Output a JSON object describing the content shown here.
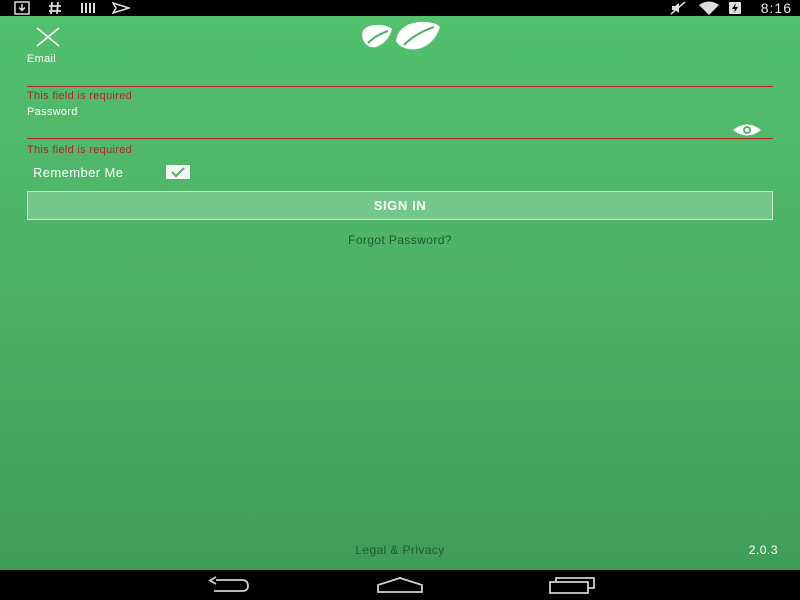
{
  "status_bar": {
    "time": "8:16",
    "left_icons": [
      "download-icon",
      "hash-icon",
      "barcode-icon",
      "plane-icon"
    ],
    "right_icons": [
      "mute-icon",
      "wifi-icon",
      "battery-charging-icon"
    ]
  },
  "colors": {
    "accent": "#4db267",
    "error": "#b3261e",
    "link_text": "#1f5a2f"
  },
  "header": {
    "close_icon": "close-icon",
    "logo_icon": "leaf-logo-icon"
  },
  "form": {
    "email": {
      "label": "Email",
      "value": "",
      "error": "This field is required"
    },
    "password": {
      "label": "Password",
      "value": "",
      "error": "This field is required",
      "toggle_icon": "eye-icon"
    },
    "remember_me": {
      "label": "Remember Me",
      "checked": true
    },
    "signin_label": "SIGN IN",
    "forgot_label": "Forgot Password?"
  },
  "footer": {
    "legal_label": "Legal & Privacy",
    "version": "2.0.3"
  },
  "nav_bar": {
    "buttons": [
      "back-icon",
      "home-icon",
      "recents-icon"
    ]
  }
}
